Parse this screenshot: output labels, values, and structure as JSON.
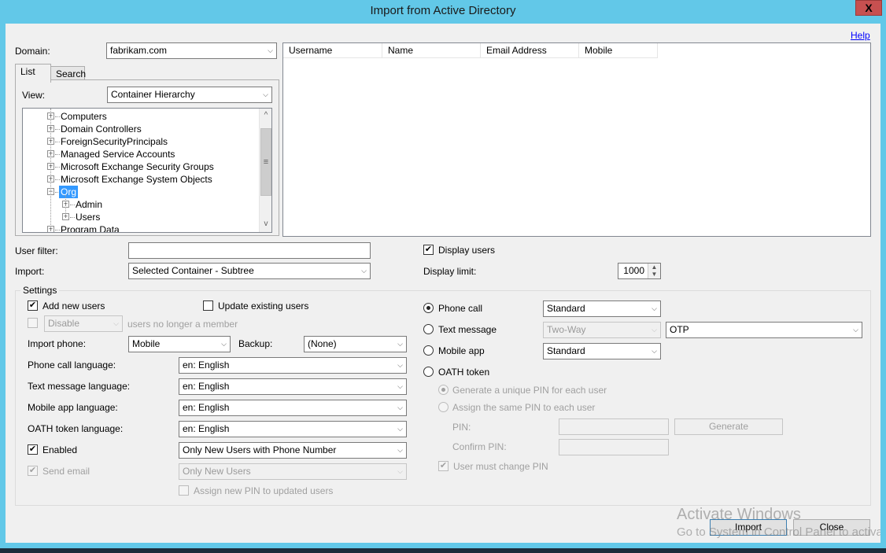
{
  "window": {
    "title": "Import from Active Directory",
    "close_label": "X",
    "help_link": "Help"
  },
  "domain": {
    "label": "Domain:",
    "value": "fabrikam.com"
  },
  "tabs": [
    {
      "label": "List",
      "active": true
    },
    {
      "label": "Search",
      "active": false
    }
  ],
  "view": {
    "label": "View:",
    "value": "Container Hierarchy"
  },
  "tree": {
    "nodes": [
      {
        "label": "Computers",
        "level": 0,
        "expander": "+",
        "selected": false
      },
      {
        "label": "Domain Controllers",
        "level": 0,
        "expander": "+",
        "selected": false
      },
      {
        "label": "ForeignSecurityPrincipals",
        "level": 0,
        "expander": "+",
        "selected": false
      },
      {
        "label": "Managed Service Accounts",
        "level": 0,
        "expander": "+",
        "selected": false
      },
      {
        "label": "Microsoft Exchange Security Groups",
        "level": 0,
        "expander": "+",
        "selected": false
      },
      {
        "label": "Microsoft Exchange System Objects",
        "level": 0,
        "expander": "+",
        "selected": false
      },
      {
        "label": "Org",
        "level": 0,
        "expander": "−",
        "selected": true
      },
      {
        "label": "Admin",
        "level": 1,
        "expander": "+",
        "selected": false
      },
      {
        "label": "Users",
        "level": 1,
        "expander": "+",
        "selected": false
      },
      {
        "label": "Program Data",
        "level": 0,
        "expander": "+",
        "selected": false
      }
    ],
    "scroll_up_icon": "^",
    "scroll_down_icon": "v",
    "scroll_grip_icon": "≡"
  },
  "user_list": {
    "columns": [
      "Username",
      "Name",
      "Email Address",
      "Mobile"
    ],
    "rows": []
  },
  "user_filter": {
    "label": "User filter:",
    "value": ""
  },
  "import_scope": {
    "label": "Import:",
    "value": "Selected Container - Subtree"
  },
  "display_users": {
    "label": "Display users",
    "checked": true
  },
  "display_limit": {
    "label": "Display limit:",
    "value": "1000"
  },
  "settings": {
    "title": "Settings",
    "add_new_users": {
      "label": "Add new users",
      "checked": true
    },
    "update_existing_users": {
      "label": "Update existing users",
      "checked": false
    },
    "disable_members": {
      "checked": false,
      "action": "Disable",
      "suffix": "users no longer a member"
    },
    "import_phone": {
      "label": "Import phone:",
      "value": "Mobile"
    },
    "backup": {
      "label": "Backup:",
      "value": "(None)"
    },
    "phone_call_language": {
      "label": "Phone call language:",
      "value": "en: English"
    },
    "text_message_language": {
      "label": "Text message language:",
      "value": "en: English"
    },
    "mobile_app_language": {
      "label": "Mobile app language:",
      "value": "en: English"
    },
    "oath_token_language": {
      "label": "OATH token language:",
      "value": "en: English"
    },
    "enabled": {
      "label": "Enabled",
      "checked": true,
      "value": "Only New Users with Phone Number"
    },
    "send_email": {
      "label": "Send email",
      "checked": true,
      "value": "Only New Users"
    },
    "assign_new_pin": {
      "label": "Assign new PIN to updated users",
      "checked": false
    },
    "methods": {
      "phone_call": {
        "label": "Phone call",
        "selected": true,
        "mode": "Standard"
      },
      "text_message": {
        "label": "Text message",
        "selected": false,
        "mode": "Two-Way",
        "type": "OTP"
      },
      "mobile_app": {
        "label": "Mobile app",
        "selected": false,
        "mode": "Standard"
      },
      "oath_token": {
        "label": "OATH token",
        "selected": false
      }
    },
    "pin": {
      "generate_unique": {
        "label": "Generate a unique PIN for each user",
        "selected": true
      },
      "assign_same": {
        "label": "Assign the same PIN to each user",
        "selected": false
      },
      "pin_label": "PIN:",
      "pin_value": "",
      "confirm_label": "Confirm PIN:",
      "confirm_value": "",
      "generate_button": "Generate",
      "must_change": {
        "label": "User must change PIN",
        "checked": true
      }
    }
  },
  "buttons": {
    "import": "Import",
    "close": "Close"
  },
  "watermark": {
    "line1": "Activate Windows",
    "line2": "Go to System in Control Panel to activate Windows."
  },
  "colors": {
    "title_bar": "#62c8e8",
    "close_button": "#c75050",
    "selection": "#3399ff",
    "link": "#0000ff"
  }
}
